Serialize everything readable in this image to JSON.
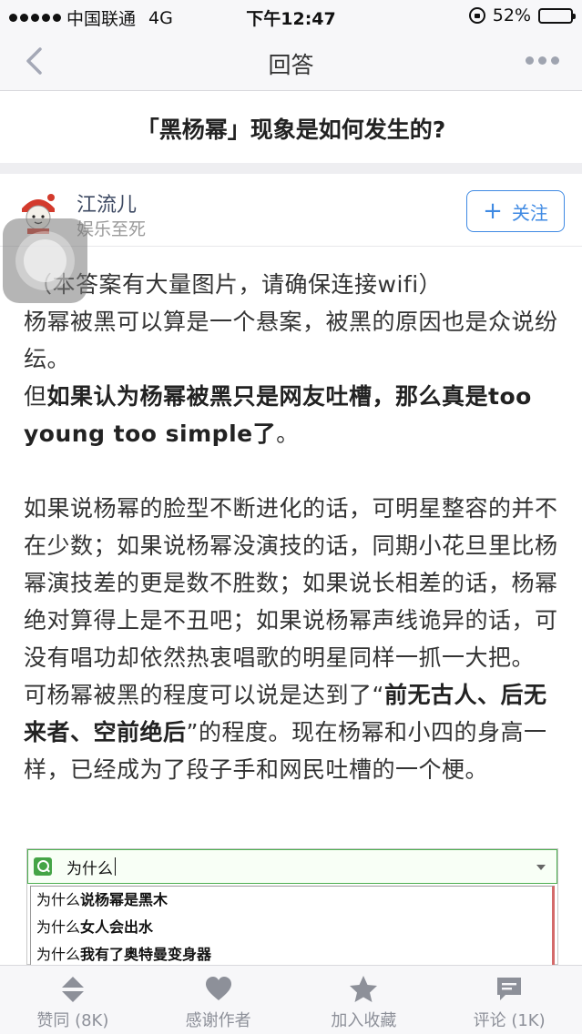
{
  "status_bar": {
    "carrier": "中国联通",
    "network": "4G",
    "time": "下午12:47",
    "battery": "52%",
    "battery_level": 0.52
  },
  "nav": {
    "title": "回答"
  },
  "question": {
    "title": "「黑杨幂」现象是如何发生的?"
  },
  "author": {
    "name": "江流儿",
    "bio": "娱乐至死",
    "follow_label": "关注"
  },
  "answer": {
    "p1": "（本答案有大量图片，请确保连接wifi）",
    "p2": "杨幂被黑可以算是一个悬案，被黑的原因也是众说纷纭。",
    "p3_pre": "但",
    "p3_bold": "如果认为杨幂被黑只是网友吐槽，那么真是too young too simple了",
    "p3_post": "。",
    "p4": "如果说杨幂的脸型不断进化的话，可明星整容的并不在少数；如果说杨幂没演技的话，同期小花旦里比杨幂演技差的更是数不胜数；如果说长相差的话，杨幂绝对算得上是不丑吧；如果说杨幂声线诡异的话，可没有唱功却依然热衷唱歌的明星同样一抓一大把。",
    "p5_a": "可杨幂被黑的程度可以说是达到了“",
    "p5_bold": "前无古人、后无来者、空前绝后",
    "p5_b": "”的程度。现在杨幂和小四的身高一样，已经成为了段子手和网民吐槽的一个梗。"
  },
  "embedded_image": {
    "query": "为什么",
    "suggestions": [
      {
        "prefix": "为什么",
        "bold": "说杨幂是黑木"
      },
      {
        "prefix": "为什么",
        "bold": "女人会出水"
      },
      {
        "prefix": "为什么",
        "bold": "我有了奥特曼变身器"
      }
    ]
  },
  "tab_bar": {
    "items": [
      {
        "label": "赞同 (8K)",
        "icon": "vote-arrows-icon"
      },
      {
        "label": "感谢作者",
        "icon": "heart-icon"
      },
      {
        "label": "加入收藏",
        "icon": "star-icon"
      },
      {
        "label": "评论 (1K)",
        "icon": "comment-icon"
      }
    ],
    "icon_color": "#8d9099"
  },
  "colors": {
    "accent": "#3f8ae3",
    "author_name": "#3e4a63"
  }
}
